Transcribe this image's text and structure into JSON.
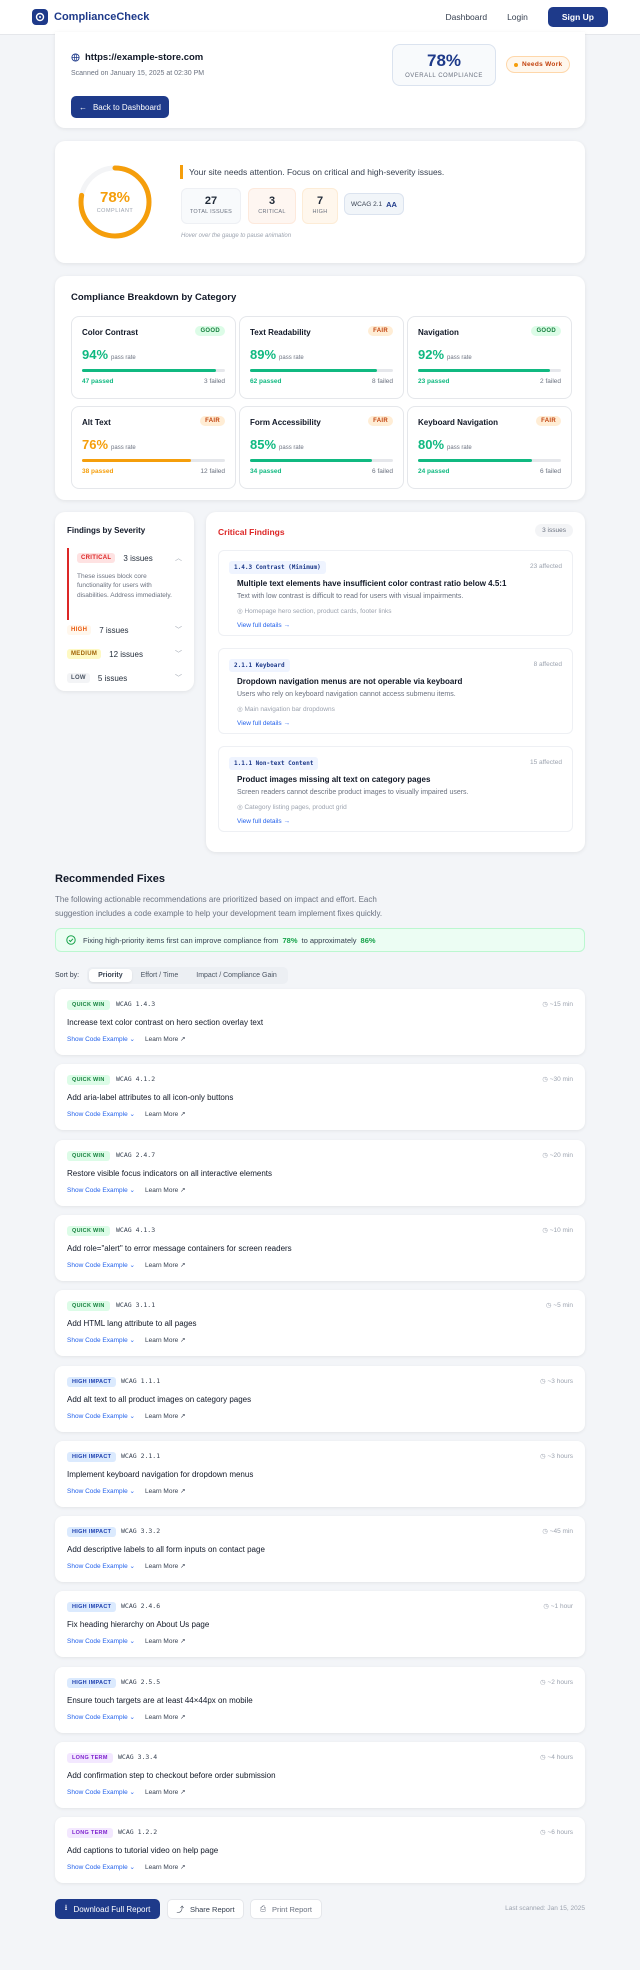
{
  "nav": {
    "brand": "ComplianceCheck",
    "dashboard": "Dashboard",
    "login": "Login",
    "signup": "Sign Up"
  },
  "header": {
    "url": "https://example-store.com",
    "scanned": "Scanned on January 15, 2025 at 02:30 PM",
    "back": "Back to Dashboard",
    "score": "78%",
    "score_label": "OVERALL COMPLIANCE",
    "status": "Needs Work"
  },
  "summary": {
    "gauge_value": "78%",
    "gauge_label": "COMPLIANT",
    "gauge_fraction": 0.78,
    "message": "Your site needs attention. Focus on critical and high-severity issues.",
    "total": "27",
    "total_label": "TOTAL ISSUES",
    "critical": "3",
    "critical_label": "CRITICAL",
    "high": "7",
    "high_label": "HIGH",
    "wcag": "WCAG 2.1",
    "wcag_level": "AA",
    "hint": "Hover over the gauge to pause animation"
  },
  "breakdown": {
    "title": "Compliance Breakdown by Category",
    "pass_rate_label": "pass rate",
    "categories": [
      {
        "name": "Color Contrast",
        "badge": "GOOD",
        "rate": "94%",
        "fraction": 0.94,
        "passed": "47 passed",
        "failed": "3 failed"
      },
      {
        "name": "Text Readability",
        "badge": "FAIR",
        "rate": "89%",
        "fraction": 0.89,
        "passed": "62 passed",
        "failed": "8 failed"
      },
      {
        "name": "Navigation",
        "badge": "GOOD",
        "rate": "92%",
        "fraction": 0.92,
        "passed": "23 passed",
        "failed": "2 failed"
      },
      {
        "name": "Alt Text",
        "badge": "FAIR",
        "rate": "76%",
        "fraction": 0.76,
        "passed": "38 passed",
        "failed": "12 failed"
      },
      {
        "name": "Form Accessibility",
        "badge": "FAIR",
        "rate": "85%",
        "fraction": 0.85,
        "passed": "34 passed",
        "failed": "6 failed"
      },
      {
        "name": "Keyboard Navigation",
        "badge": "FAIR",
        "rate": "80%",
        "fraction": 0.8,
        "passed": "24 passed",
        "failed": "6 failed"
      }
    ]
  },
  "severity": {
    "title": "Findings by Severity",
    "critical_tag": "CRITICAL",
    "critical_count": "3 issues",
    "critical_note": "These issues block core functionality for users with disabilities. Address immediately.",
    "high_tag": "HIGH",
    "high_count": "7 issues",
    "medium_tag": "MEDIUM",
    "medium_count": "12 issues",
    "low_tag": "LOW",
    "low_count": "5 issues"
  },
  "critical": {
    "title": "Critical Findings",
    "count": "3 issues",
    "view": "View full details",
    "items": [
      {
        "code": "1.4.3 Contrast (Minimum)",
        "affected": "23 affected",
        "title": "Multiple text elements have insufficient color contrast ratio below 4.5:1",
        "desc": "Text with low contrast is difficult to read for users with visual impairments.",
        "location": "Homepage hero section, product cards, footer links"
      },
      {
        "code": "2.1.1 Keyboard",
        "affected": "8 affected",
        "title": "Dropdown navigation menus are not operable via keyboard",
        "desc": "Users who rely on keyboard navigation cannot access submenu items.",
        "location": "Main navigation bar dropdowns"
      },
      {
        "code": "1.1.1 Non-text Content",
        "affected": "15 affected",
        "title": "Product images missing alt text on category pages",
        "desc": "Screen readers cannot describe product images to visually impaired users.",
        "location": "Category listing pages, product grid"
      }
    ]
  },
  "fixes": {
    "title": "Recommended Fixes",
    "intro1": "The following actionable recommendations are prioritized based on impact and effort. Each",
    "intro2": "suggestion includes a code example to help your development team implement fixes quickly.",
    "tip_a": "Fixing high-priority items first can improve compliance from",
    "tip_from": "78%",
    "tip_b": "to approximately",
    "tip_to": "86%",
    "sort_label": "Sort by:",
    "sort_options": [
      "Priority",
      "Effort / Time",
      "Impact / Compliance Gain"
    ],
    "show_code": "Show Code Example",
    "learn_more": "Learn More",
    "items": [
      {
        "badge": "QUICK WIN",
        "kind": "qw",
        "wcag": "WCAG 1.4.3",
        "time": "~15 min",
        "title": "Increase text color contrast on hero section overlay text"
      },
      {
        "badge": "QUICK WIN",
        "kind": "qw",
        "wcag": "WCAG 4.1.2",
        "time": "~30 min",
        "title": "Add aria-label attributes to all icon-only buttons"
      },
      {
        "badge": "QUICK WIN",
        "kind": "qw",
        "wcag": "WCAG 2.4.7",
        "time": "~20 min",
        "title": "Restore visible focus indicators on all interactive elements"
      },
      {
        "badge": "QUICK WIN",
        "kind": "qw",
        "wcag": "WCAG 4.1.3",
        "time": "~10 min",
        "title": "Add role=\"alert\" to error message containers for screen readers"
      },
      {
        "badge": "QUICK WIN",
        "kind": "qw",
        "wcag": "WCAG 3.1.1",
        "time": "~5 min",
        "title": "Add HTML lang attribute to all pages"
      },
      {
        "badge": "HIGH IMPACT",
        "kind": "hi",
        "wcag": "WCAG 1.1.1",
        "time": "~3 hours",
        "title": "Add alt text to all product images on category pages"
      },
      {
        "badge": "HIGH IMPACT",
        "kind": "hi",
        "wcag": "WCAG 2.1.1",
        "time": "~3 hours",
        "title": "Implement keyboard navigation for dropdown menus"
      },
      {
        "badge": "HIGH IMPACT",
        "kind": "hi",
        "wcag": "WCAG 3.3.2",
        "time": "~45 min",
        "title": "Add descriptive labels to all form inputs on contact page"
      },
      {
        "badge": "HIGH IMPACT",
        "kind": "hi",
        "wcag": "WCAG 2.4.6",
        "time": "~1 hour",
        "title": "Fix heading hierarchy on About Us page"
      },
      {
        "badge": "HIGH IMPACT",
        "kind": "hi",
        "wcag": "WCAG 2.5.5",
        "time": "~2 hours",
        "title": "Ensure touch targets are at least 44×44px on mobile"
      },
      {
        "badge": "LONG TERM",
        "kind": "lt",
        "wcag": "WCAG 3.3.4",
        "time": "~4 hours",
        "title": "Add confirmation step to checkout before order submission"
      },
      {
        "badge": "LONG TERM",
        "kind": "lt",
        "wcag": "WCAG 1.2.2",
        "time": "~6 hours",
        "title": "Add captions to tutorial video on help page"
      }
    ]
  },
  "footer": {
    "download": "Download Full Report",
    "share": "Share Report",
    "print": "Print Report",
    "last_scanned": "Last scanned: Jan 15, 2025"
  },
  "colors": {
    "brand": "#1e3a8a",
    "good": "#10b981",
    "fair": "#f59e0b",
    "critical": "#dc2626",
    "link": "#2563eb"
  }
}
